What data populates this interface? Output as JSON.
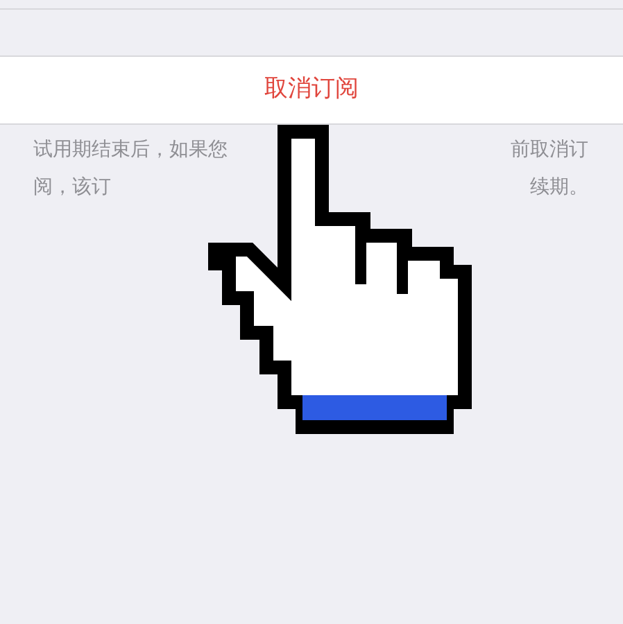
{
  "cancel_button": {
    "label": "取消订阅"
  },
  "note_lines": [
    {
      "start": "试用期结束后，如果您",
      "end": "前取消订"
    },
    {
      "start": "阅，该订",
      "end": "续期。"
    }
  ]
}
